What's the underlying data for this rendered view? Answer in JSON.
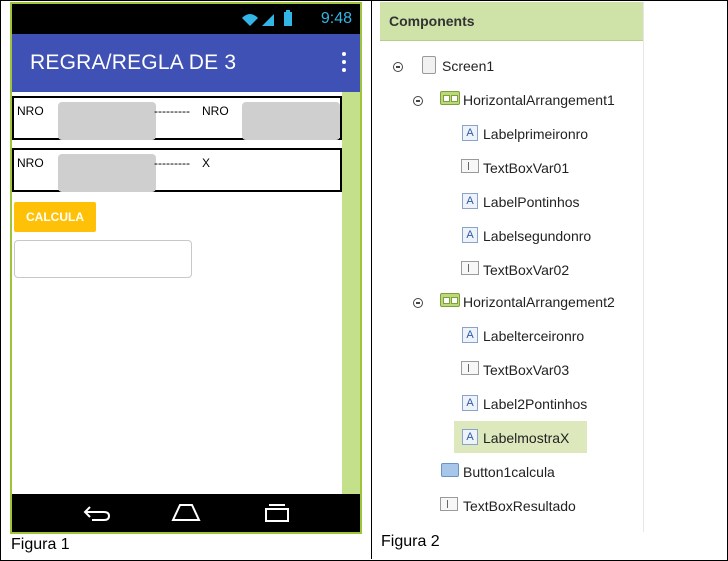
{
  "figure1": {
    "caption": "Figura 1",
    "status": {
      "time": "9:48"
    },
    "app": {
      "title": "REGRA/REGLA DE 3"
    },
    "row1": {
      "label1": "NRO",
      "dashes": "---------",
      "label2": "NRO"
    },
    "row2": {
      "label1": "NRO",
      "dashes": "---------",
      "label2": "X"
    },
    "button": {
      "label": "CALCULA"
    },
    "colors": {
      "appbar": "#3f51b5",
      "button": "#ffc107",
      "frame": "#9dc43b"
    }
  },
  "figure2": {
    "caption": "Figura 2",
    "header": "Components",
    "tree": [
      {
        "label": "Screen1",
        "icon": "screen-icon"
      },
      {
        "label": "HorizontalArrangement1",
        "icon": "horizontal-arrangement-icon"
      },
      {
        "label": "Labelprimeironro",
        "icon": "label-icon"
      },
      {
        "label": "TextBoxVar01",
        "icon": "textbox-icon"
      },
      {
        "label": "LabelPontinhos",
        "icon": "label-icon"
      },
      {
        "label": "Labelsegundonro",
        "icon": "label-icon"
      },
      {
        "label": "TextBoxVar02",
        "icon": "textbox-icon"
      },
      {
        "label": "HorizontalArrangement2",
        "icon": "horizontal-arrangement-icon"
      },
      {
        "label": "Labelterceironro",
        "icon": "label-icon"
      },
      {
        "label": "TextBoxVar03",
        "icon": "textbox-icon"
      },
      {
        "label": "Label2Pontinhos",
        "icon": "label-icon"
      },
      {
        "label": "LabelmostraX",
        "icon": "label-icon",
        "selected": true
      },
      {
        "label": "Button1calcula",
        "icon": "button-icon"
      },
      {
        "label": "TextBoxResultado",
        "icon": "textbox-icon"
      }
    ],
    "label_icon_glyph": "A"
  }
}
